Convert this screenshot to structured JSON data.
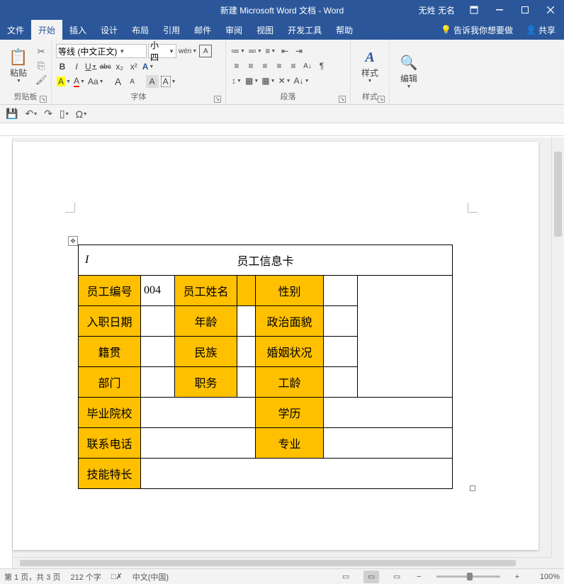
{
  "titlebar": {
    "doc_title": "新建 Microsoft Word 文档  -  Word",
    "user": "无姓 无名"
  },
  "tabs": {
    "file": "文件",
    "home": "开始",
    "insert": "插入",
    "design": "设计",
    "layout": "布局",
    "references": "引用",
    "mail": "邮件",
    "review": "审阅",
    "view": "视图",
    "dev": "开发工具",
    "help": "帮助",
    "tell_me": "告诉我你想要做",
    "share": "共享"
  },
  "ribbon": {
    "clipboard": {
      "label": "剪贴板",
      "paste": "粘贴"
    },
    "font": {
      "label": "字体",
      "family": "等线 (中文正文)",
      "size": "小四",
      "wen": "wén",
      "a_char": "A"
    },
    "paragraph": {
      "label": "段落"
    },
    "styles": {
      "label": "样式",
      "btn": "样式"
    },
    "editing": {
      "label": "编辑",
      "btn": "编辑"
    }
  },
  "table": {
    "title": "员工信息卡",
    "rows": [
      {
        "c1": "员工编号",
        "v1": "004",
        "c2": "员工姓名",
        "v2": "",
        "c3": "性别",
        "v3": ""
      },
      {
        "c1": "入职日期",
        "v1": "",
        "c2": "年龄",
        "v2": "",
        "c3": "政治面貌",
        "v3": ""
      },
      {
        "c1": "籍贯",
        "v1": "",
        "c2": "民族",
        "v2": "",
        "c3": "婚姻状况",
        "v3": ""
      },
      {
        "c1": "部门",
        "v1": "",
        "c2": "职务",
        "v2": "",
        "c3": "工龄",
        "v3": ""
      },
      {
        "c1": "毕业院校",
        "v1": "",
        "c3": "学历",
        "v3": ""
      },
      {
        "c1": "联系电话",
        "v1": "",
        "c3": "专业",
        "v3": ""
      },
      {
        "c1": "技能特长",
        "v1": ""
      }
    ]
  },
  "status": {
    "page": "第 1 页，共 3 页",
    "words": "212 个字",
    "lang_icon": "",
    "lang": "中文(中国)",
    "zoom": "100%",
    "minus": "−",
    "plus": "+"
  },
  "glyphs": {
    "cut": "✂",
    "copy": "⎘",
    "brush": "🖌",
    "bold": "B",
    "italic": "I",
    "underline": "U",
    "strike": "abc",
    "sub": "x₂",
    "sup": "x²",
    "grow": "A",
    "shrink": "A",
    "case": "Aa",
    "clear": "A",
    "hilite": "A",
    "color": "A",
    "phonetic": "A",
    "border_char": "A",
    "bullets": "≔",
    "numbering": "≕",
    "multilevel": "≡",
    "dec_indent": "⇤",
    "inc_indent": "⇥",
    "sort": "A↓",
    "marks": "¶",
    "al": "≡",
    "ac": "≡",
    "ar": "≡",
    "aj": "≡",
    "dist": "≡",
    "linespace": "↕",
    "shading": "▦",
    "borders": "▦",
    "save": "💾",
    "undo": "↶",
    "redo": "↷",
    "filemenu": "▯",
    "omega": "Ω",
    "bulb": "💡",
    "personshare": "👤",
    "viewread": "▭",
    "viewprint": "▭",
    "viewweb": "▭"
  }
}
